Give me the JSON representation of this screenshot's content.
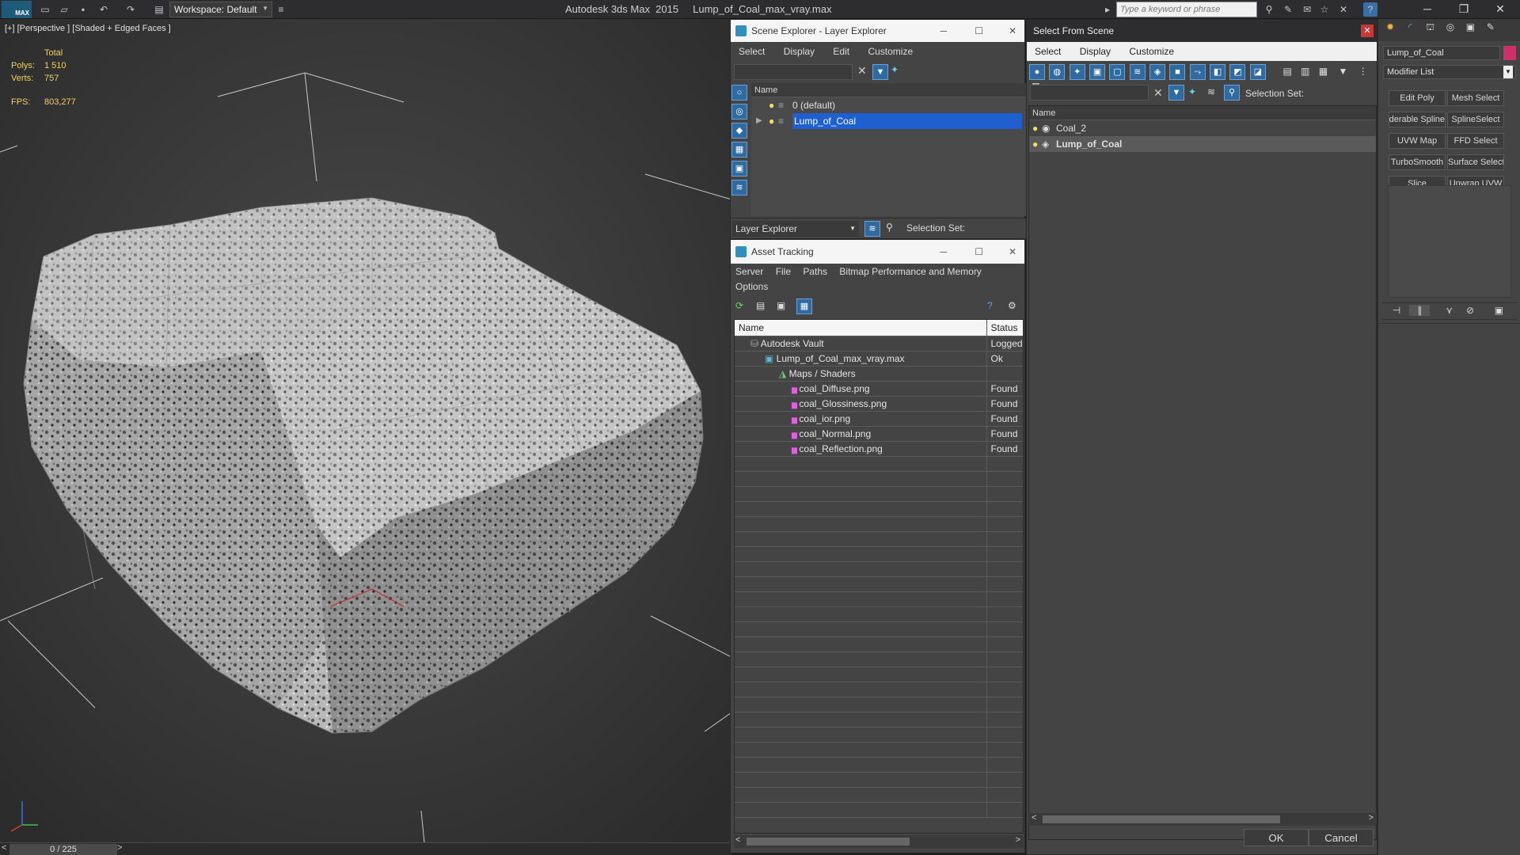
{
  "app": {
    "title": "Autodesk 3ds Max  2015     Lump_of_Coal_max_vray.max",
    "logo_text": "MAX",
    "workspace": "Workspace: Default",
    "search_placeholder": "Type a keyword or phrase"
  },
  "viewport": {
    "label": "[+] [Perspective ] [Shaded + Edged Faces ]",
    "stats": {
      "total_label": "Total",
      "polys_label": "Polys:",
      "polys_value": "1 510",
      "verts_label": "Verts:",
      "verts_value": "757",
      "fps_label": "FPS:",
      "fps_value": "803,277"
    }
  },
  "timeline": {
    "position": "0 / 225"
  },
  "layer_explorer": {
    "title": "Scene Explorer - Layer Explorer",
    "menu": [
      "Select",
      "Display",
      "Edit",
      "Customize"
    ],
    "column_name": "Name",
    "rows": [
      {
        "label": "0 (default)",
        "selected": false
      },
      {
        "label": "Lump_of_Coal",
        "selected": true
      }
    ],
    "footer_dropdown": "Layer Explorer",
    "footer_selection_set": "Selection Set:"
  },
  "asset_tracking": {
    "title": "Asset Tracking",
    "menu": [
      "Server",
      "File",
      "Paths",
      "Bitmap Performance and Memory"
    ],
    "menu_row2": [
      "Options"
    ],
    "columns": {
      "name": "Name",
      "status": "Status"
    },
    "rows": [
      {
        "name": "Autodesk Vault",
        "status": "Logged",
        "indent": 0
      },
      {
        "name": "Lump_of_Coal_max_vray.max",
        "status": "Ok",
        "indent": 1
      },
      {
        "name": "Maps / Shaders",
        "status": "",
        "indent": 2
      },
      {
        "name": "coal_Diffuse.png",
        "status": "Found",
        "indent": 3
      },
      {
        "name": "coal_Glossiness.png",
        "status": "Found",
        "indent": 3
      },
      {
        "name": "coal_ior.png",
        "status": "Found",
        "indent": 3
      },
      {
        "name": "coal_Normal.png",
        "status": "Found",
        "indent": 3
      },
      {
        "name": "coal_Reflection.png",
        "status": "Found",
        "indent": 3
      }
    ]
  },
  "select_from_scene": {
    "title": "Select From Scene",
    "menu": [
      "Select",
      "Display",
      "Customize"
    ],
    "selection_set": "Selection Set:",
    "column_name": "Name",
    "rows": [
      {
        "label": "Coal_2",
        "selected": false
      },
      {
        "label": "Lump_of_Coal",
        "selected": true
      }
    ],
    "ok": "OK",
    "cancel": "Cancel"
  },
  "command_panel": {
    "object_name": "Lump_of_Coal",
    "object_color": "#d0306a",
    "modifier_list": "Modifier List",
    "modifiers": [
      "Edit Poly",
      "Mesh Select",
      "Renderable Spline",
      "SplineSelect",
      "UVW Map",
      "FFD Select",
      "TurboSmooth",
      "Surface Select",
      "Slice",
      "Unwrap UVW"
    ]
  }
}
